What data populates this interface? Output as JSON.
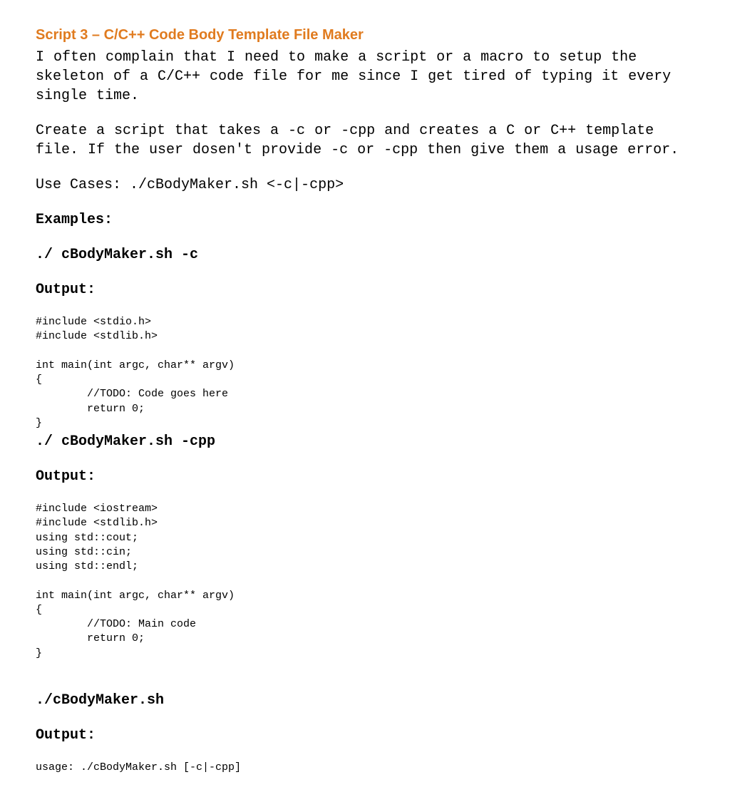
{
  "heading": "Script 3 – C/C++ Code Body Template File Maker",
  "para1": "I often complain that I need to make a script or a macro to setup the skeleton of a C/C++ code file for me since I get tired of typing it every single time.",
  "para2": "Create a script that takes a -c or -cpp and creates a C or C++ template file.  If the user dosen't provide -c or -cpp then give them a usage error.",
  "usecases": "Use Cases: ./cBodyMaker.sh <-c|-cpp>",
  "examples_label": "Examples:",
  "ex1_cmd": "./ cBodyMaker.sh -c",
  "output_label": "Output:",
  "code_c": "#include <stdio.h>\n#include <stdlib.h>\n\nint main(int argc, char** argv)\n{\n        //TODO: Code goes here\n        return 0;\n}",
  "ex2_cmd": "./ cBodyMaker.sh -cpp",
  "code_cpp": "#include <iostream>\n#include <stdlib.h>\nusing std::cout;\nusing std::cin;\nusing std::endl;\n\nint main(int argc, char** argv)\n{\n        //TODO: Main code\n        return 0;\n}",
  "ex3_cmd": "./cBodyMaker.sh",
  "code_usage": "usage: ./cBodyMaker.sh [-c|-cpp]"
}
